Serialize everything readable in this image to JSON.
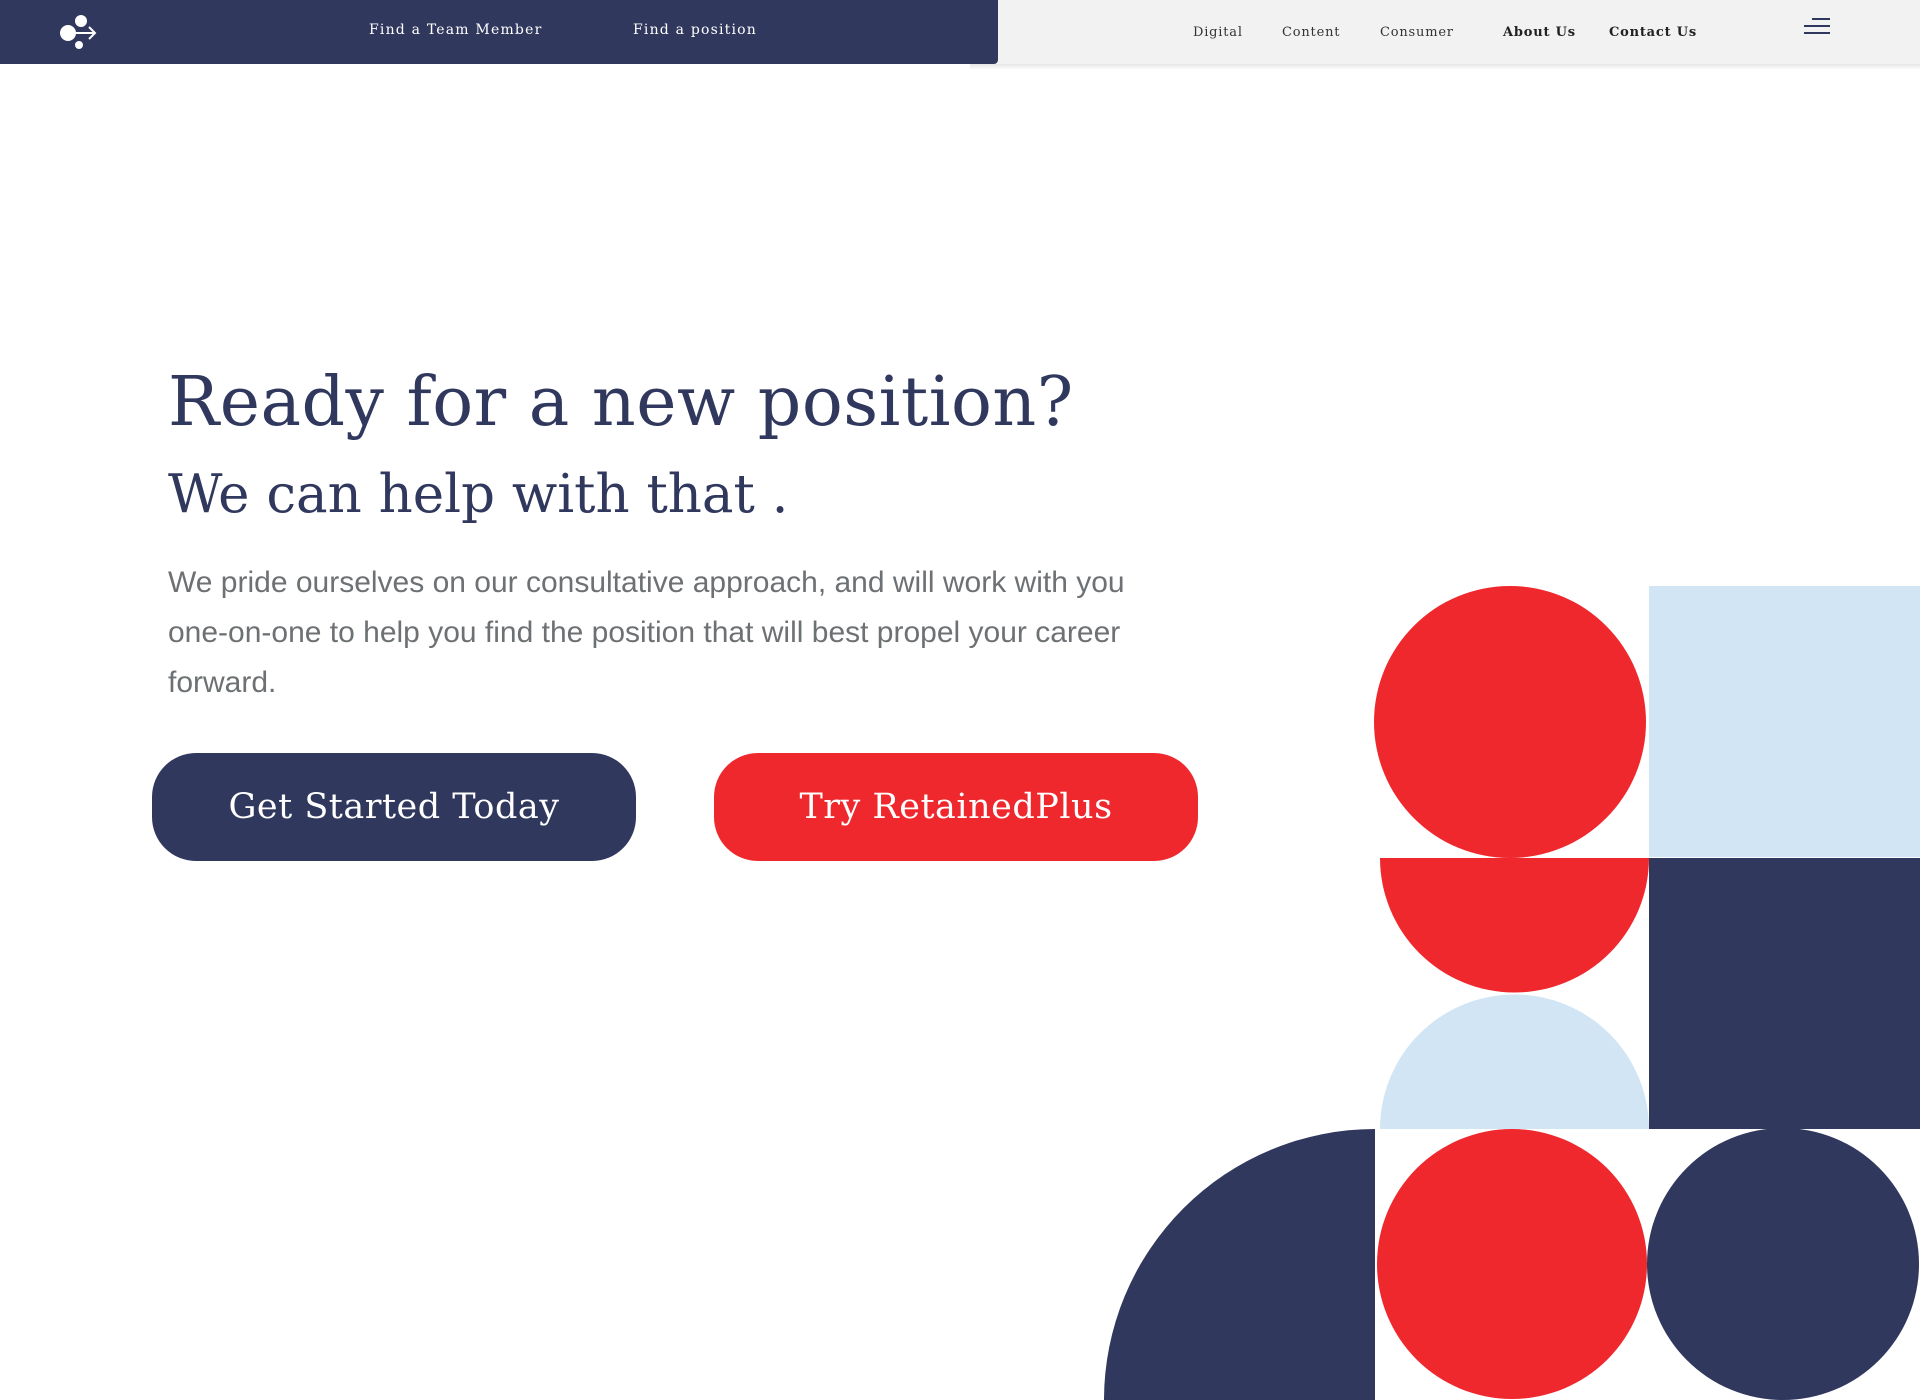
{
  "header": {
    "left_links": [
      {
        "label": "Find a Team Member"
      },
      {
        "label": "Find a position"
      }
    ],
    "right_links": [
      {
        "label": "Digital"
      },
      {
        "label": "Content"
      },
      {
        "label": "Consumer"
      },
      {
        "label": "About Us"
      },
      {
        "label": "Contact Us"
      }
    ],
    "menu_icon": "hamburger-menu-icon",
    "logo_icon": "brand-logo-icon"
  },
  "hero": {
    "title": "Ready for a new position?",
    "subtitle": "We can help with that .",
    "body": "We pride ourselves on our consultative approach, and will work with you one-on-one to help you find the position that will best propel your career forward.",
    "primary_button": "Get Started Today",
    "secondary_button": "Try RetainedPlus"
  },
  "colors": {
    "navy": "#30385e",
    "red": "#ef282e",
    "light_blue": "#d1e5f5",
    "header_right_bg": "#f2f2f2",
    "body_text": "#6d7173"
  }
}
